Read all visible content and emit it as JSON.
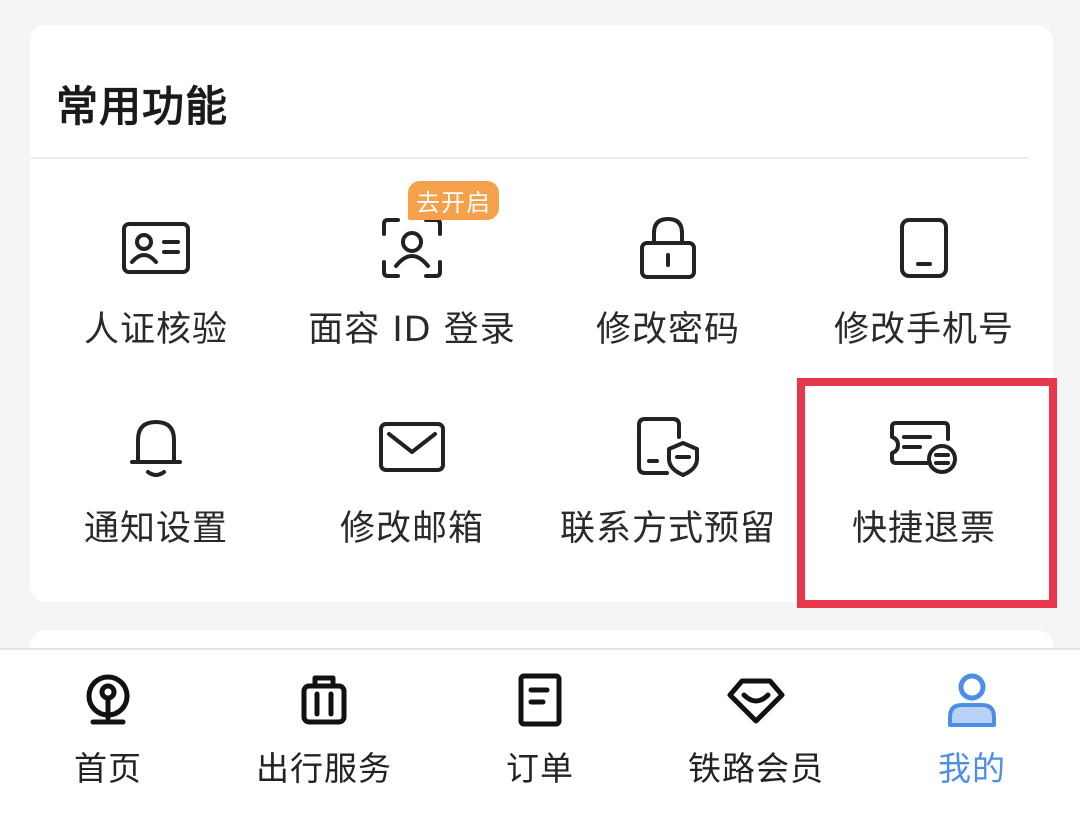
{
  "card": {
    "title": "常用功能",
    "badge": "去开启",
    "items": [
      {
        "label": "人证核验",
        "icon": "id-card-icon"
      },
      {
        "label": "面容 ID 登录",
        "icon": "face-scan-icon"
      },
      {
        "label": "修改密码",
        "icon": "lock-icon"
      },
      {
        "label": "修改手机号",
        "icon": "phone-icon"
      },
      {
        "label": "通知设置",
        "icon": "bell-icon"
      },
      {
        "label": "修改邮箱",
        "icon": "envelope-icon"
      },
      {
        "label": "联系方式预留",
        "icon": "contact-shield-icon"
      },
      {
        "label": "快捷退票",
        "icon": "ticket-refund-icon"
      }
    ]
  },
  "tabs": [
    {
      "label": "首页",
      "icon": "railway-logo-icon"
    },
    {
      "label": "出行服务",
      "icon": "luggage-icon"
    },
    {
      "label": "订单",
      "icon": "order-document-icon"
    },
    {
      "label": "铁路会员",
      "icon": "diamond-icon"
    },
    {
      "label": "我的",
      "icon": "user-icon",
      "active": true
    }
  ],
  "colors": {
    "active_tab": "#4d8fe6",
    "badge": "#f5a04a",
    "highlight": "#e8364a"
  }
}
